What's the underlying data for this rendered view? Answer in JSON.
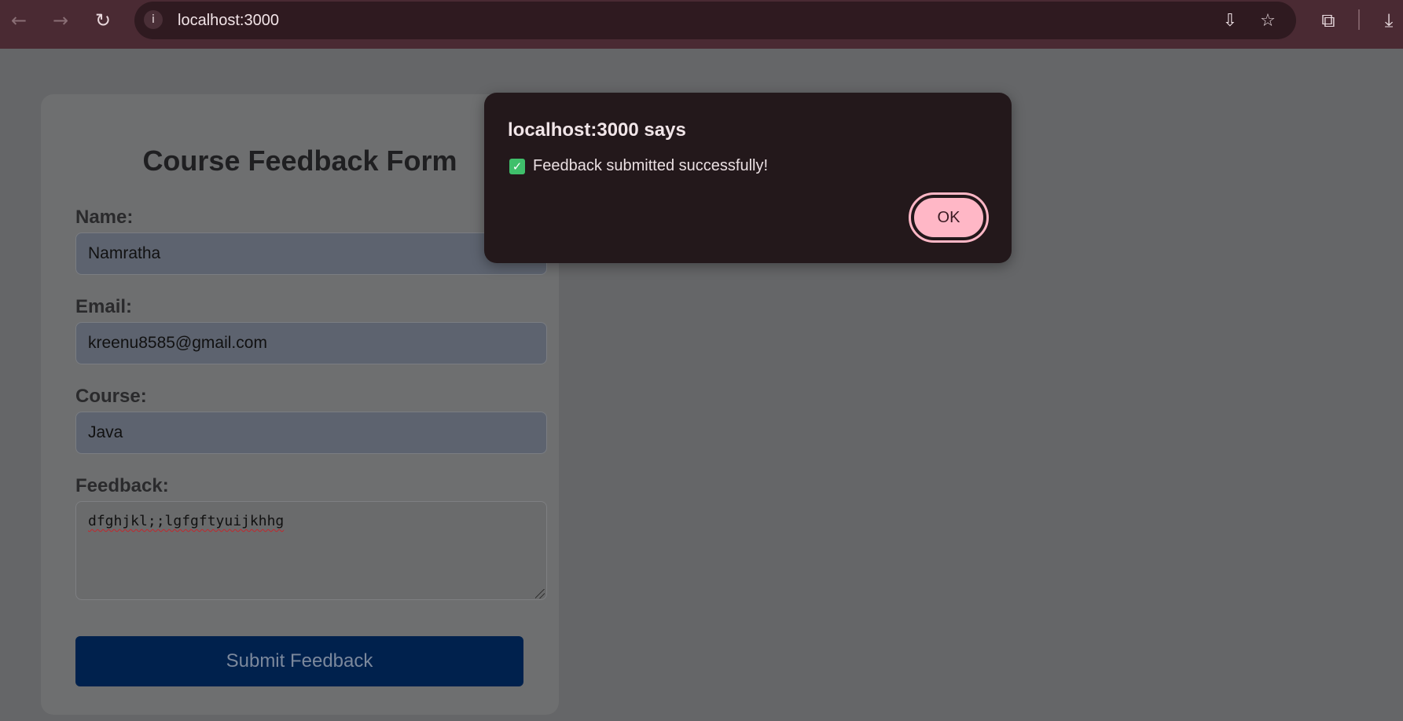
{
  "browser": {
    "url": "localhost:3000",
    "icons": {
      "back": "arrow-left-icon",
      "forward": "arrow-right-icon",
      "reload": "reload-icon",
      "site_info": "info-icon",
      "install": "install-app-icon",
      "bookmark": "star-icon",
      "extensions": "puzzle-icon",
      "downloads": "download-icon"
    }
  },
  "form": {
    "title": "Course Feedback Form",
    "name_label": "Name:",
    "name_value": "Namratha",
    "email_label": "Email:",
    "email_value": "kreenu8585@gmail.com",
    "course_label": "Course:",
    "course_value": "Java",
    "feedback_label": "Feedback:",
    "feedback_value": "dfghjkl;;lgfgftyuijkhhg",
    "submit_label": "Submit Feedback"
  },
  "dialog": {
    "title": "localhost:3000 says",
    "message": "Feedback submitted successfully!",
    "ok_label": "OK"
  },
  "colors": {
    "toolbar": "#4a2a33",
    "dialog_bg": "#23181b",
    "ok_button": "#ffb7c6",
    "submit_button": "#00214d",
    "check": "#3fbf6b"
  }
}
